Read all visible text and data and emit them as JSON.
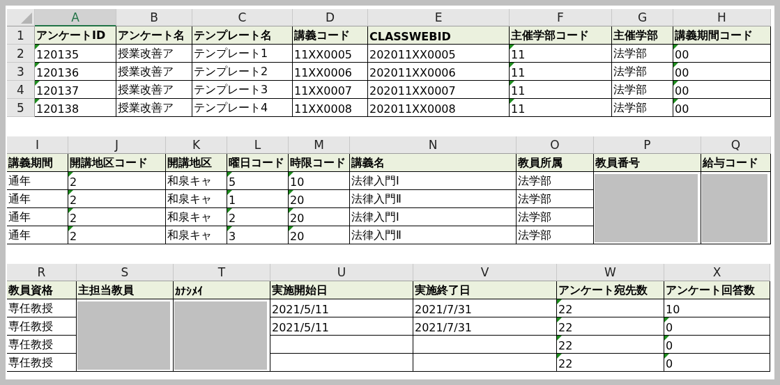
{
  "sheets": [
    {
      "row_numbers": [
        "1",
        "2",
        "3",
        "4",
        "5"
      ],
      "columns": [
        {
          "letter": "A",
          "selected": true
        },
        {
          "letter": "B",
          "selected": false
        },
        {
          "letter": "C",
          "selected": false
        },
        {
          "letter": "D",
          "selected": false
        },
        {
          "letter": "E",
          "selected": false
        },
        {
          "letter": "F",
          "selected": false
        },
        {
          "letter": "G",
          "selected": false
        },
        {
          "letter": "H",
          "selected": false
        }
      ],
      "header": [
        "アンケートID",
        "アンケート名",
        "テンプレート名",
        "講義コード",
        "CLASSWEBID",
        "主催学部コード",
        "主催学部",
        "講義期間コード"
      ],
      "rows": [
        [
          {
            "text": "120135",
            "flag": true
          },
          {
            "text": "授業改善ア",
            "flag": false
          },
          {
            "text": "テンプレート1",
            "flag": false
          },
          {
            "text": "11XX0005",
            "flag": false
          },
          {
            "text": "202011XX0005",
            "flag": false
          },
          {
            "text": "11",
            "flag": true
          },
          {
            "text": "法学部",
            "flag": false
          },
          {
            "text": "00",
            "flag": true
          }
        ],
        [
          {
            "text": "120136",
            "flag": true
          },
          {
            "text": "授業改善ア",
            "flag": false
          },
          {
            "text": "テンプレート2",
            "flag": false
          },
          {
            "text": "11XX0006",
            "flag": false
          },
          {
            "text": "202011XX0006",
            "flag": false
          },
          {
            "text": "11",
            "flag": true
          },
          {
            "text": "法学部",
            "flag": false
          },
          {
            "text": "00",
            "flag": true
          }
        ],
        [
          {
            "text": "120137",
            "flag": true
          },
          {
            "text": "授業改善ア",
            "flag": false
          },
          {
            "text": "テンプレート3",
            "flag": false
          },
          {
            "text": "11XX0007",
            "flag": false
          },
          {
            "text": "202011XX0007",
            "flag": false
          },
          {
            "text": "11",
            "flag": true
          },
          {
            "text": "法学部",
            "flag": false
          },
          {
            "text": "00",
            "flag": true
          }
        ],
        [
          {
            "text": "120138",
            "flag": true
          },
          {
            "text": "授業改善ア",
            "flag": false
          },
          {
            "text": "テンプレート4",
            "flag": false
          },
          {
            "text": "11XX0008",
            "flag": false
          },
          {
            "text": "202011XX0008",
            "flag": false
          },
          {
            "text": "11",
            "flag": true
          },
          {
            "text": "法学部",
            "flag": false
          },
          {
            "text": "00",
            "flag": true
          }
        ]
      ]
    },
    {
      "columns": [
        {
          "letter": "I",
          "selected": false
        },
        {
          "letter": "J",
          "selected": false
        },
        {
          "letter": "K",
          "selected": false
        },
        {
          "letter": "L",
          "selected": false
        },
        {
          "letter": "M",
          "selected": false
        },
        {
          "letter": "N",
          "selected": false
        },
        {
          "letter": "O",
          "selected": false
        },
        {
          "letter": "P",
          "selected": false
        },
        {
          "letter": "Q",
          "selected": false
        }
      ],
      "header": [
        "講義期間",
        "開講地区コード",
        "開講地区",
        "曜日コード",
        "時限コード",
        "講義名",
        "教員所属",
        "教員番号",
        "給与コード"
      ],
      "rows": [
        [
          {
            "text": "通年",
            "flag": false
          },
          {
            "text": "2",
            "flag": true
          },
          {
            "text": "和泉キャ",
            "flag": false
          },
          {
            "text": "5",
            "flag": true
          },
          {
            "text": "10",
            "flag": true
          },
          {
            "text": "法律入門Ⅰ",
            "flag": false
          },
          {
            "text": "法学部",
            "flag": false
          },
          {
            "redacted": true
          },
          {
            "redacted": true
          }
        ],
        [
          {
            "text": "通年",
            "flag": false
          },
          {
            "text": "2",
            "flag": true
          },
          {
            "text": "和泉キャ",
            "flag": false
          },
          {
            "text": "1",
            "flag": true
          },
          {
            "text": "20",
            "flag": true
          },
          {
            "text": "法律入門Ⅱ",
            "flag": false
          },
          {
            "text": "法学部",
            "flag": false
          },
          {
            "redacted": true
          },
          {
            "redacted": true
          }
        ],
        [
          {
            "text": "通年",
            "flag": false
          },
          {
            "text": "2",
            "flag": true
          },
          {
            "text": "和泉キャ",
            "flag": false
          },
          {
            "text": "2",
            "flag": true
          },
          {
            "text": "20",
            "flag": true
          },
          {
            "text": "法律入門Ⅰ",
            "flag": false
          },
          {
            "text": "法学部",
            "flag": false
          },
          {
            "redacted": true
          },
          {
            "redacted": true
          }
        ],
        [
          {
            "text": "通年",
            "flag": false
          },
          {
            "text": "2",
            "flag": true
          },
          {
            "text": "和泉キャ",
            "flag": false
          },
          {
            "text": "3",
            "flag": true
          },
          {
            "text": "20",
            "flag": true
          },
          {
            "text": "法律入門Ⅱ",
            "flag": false
          },
          {
            "text": "法学部",
            "flag": false
          },
          {
            "redacted": true
          },
          {
            "redacted": true
          }
        ]
      ]
    },
    {
      "columns": [
        {
          "letter": "R",
          "selected": false
        },
        {
          "letter": "S",
          "selected": false
        },
        {
          "letter": "T",
          "selected": false
        },
        {
          "letter": "U",
          "selected": false
        },
        {
          "letter": "V",
          "selected": false
        },
        {
          "letter": "W",
          "selected": false
        },
        {
          "letter": "X",
          "selected": false
        }
      ],
      "header": [
        "教員資格",
        "主担当教員",
        "ｶﾅｼﾒｲ",
        "実施開始日",
        "実施終了日",
        "アンケート宛先数",
        "アンケート回答数"
      ],
      "rows": [
        [
          {
            "text": "専任教授",
            "flag": false
          },
          {
            "redacted": true
          },
          {
            "redacted": true
          },
          {
            "text": "2021/5/11",
            "flag": false
          },
          {
            "text": "2021/7/31",
            "flag": false
          },
          {
            "text": "22",
            "flag": true
          },
          {
            "text": "10",
            "flag": false
          }
        ],
        [
          {
            "text": "専任教授",
            "flag": false
          },
          {
            "redacted": true
          },
          {
            "redacted": true
          },
          {
            "text": "2021/5/11",
            "flag": false
          },
          {
            "text": "2021/7/31",
            "flag": false
          },
          {
            "text": "22",
            "flag": true
          },
          {
            "text": "0",
            "flag": true
          }
        ],
        [
          {
            "text": "専任教授",
            "flag": false
          },
          {
            "redacted": true
          },
          {
            "redacted": true
          },
          {
            "flag": false
          },
          {
            "flag": false
          },
          {
            "text": "22",
            "flag": true
          },
          {
            "text": "0",
            "flag": true
          }
        ],
        [
          {
            "text": "専任教授",
            "flag": false
          },
          {
            "redacted": true
          },
          {
            "redacted": true
          },
          {
            "flag": false
          },
          {
            "flag": false
          },
          {
            "text": "22",
            "flag": true
          },
          {
            "text": "0",
            "flag": true
          }
        ]
      ]
    }
  ]
}
